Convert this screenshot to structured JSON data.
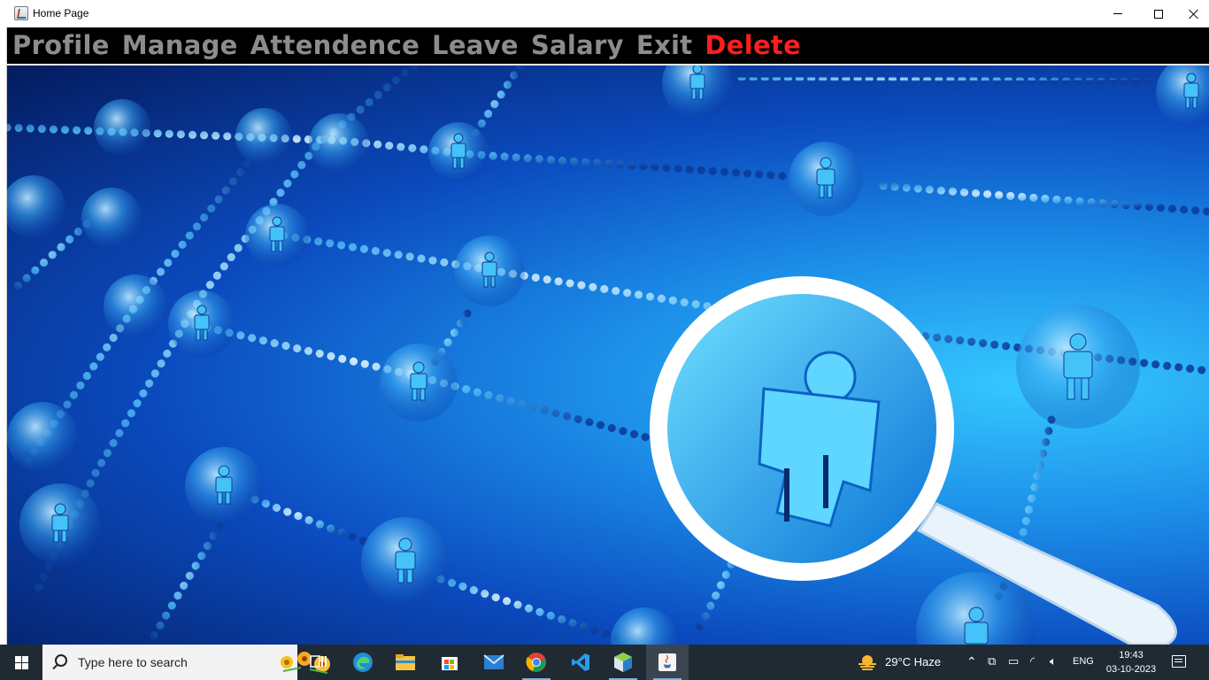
{
  "window": {
    "title": "Home Page"
  },
  "menu": {
    "items": [
      {
        "label": "Profile"
      },
      {
        "label": "Manage"
      },
      {
        "label": "Attendence"
      },
      {
        "label": "Leave"
      },
      {
        "label": "Salary"
      },
      {
        "label": "Exit"
      },
      {
        "label": "Delete"
      }
    ]
  },
  "background": {
    "description_icon": "network-people-magnifier-image"
  },
  "taskbar": {
    "search_placeholder": "Type here to search",
    "pinned": [
      {
        "icon": "task-view-icon"
      },
      {
        "icon": "edge-icon"
      },
      {
        "icon": "file-explorer-icon"
      },
      {
        "icon": "microsoft-store-icon"
      },
      {
        "icon": "mail-icon"
      },
      {
        "icon": "chrome-icon"
      },
      {
        "icon": "vscode-icon"
      },
      {
        "icon": "netbeans-icon"
      },
      {
        "icon": "java-icon"
      }
    ],
    "weather": "29°C  Haze",
    "language": "ENG",
    "time": "19:43",
    "date": "03-10-2023"
  },
  "colors": {
    "menu_bg": "#000000",
    "menu_text": "#8c8c8c",
    "menu_danger": "#ff1e1e",
    "taskbar_bg": "#1f2a33"
  }
}
